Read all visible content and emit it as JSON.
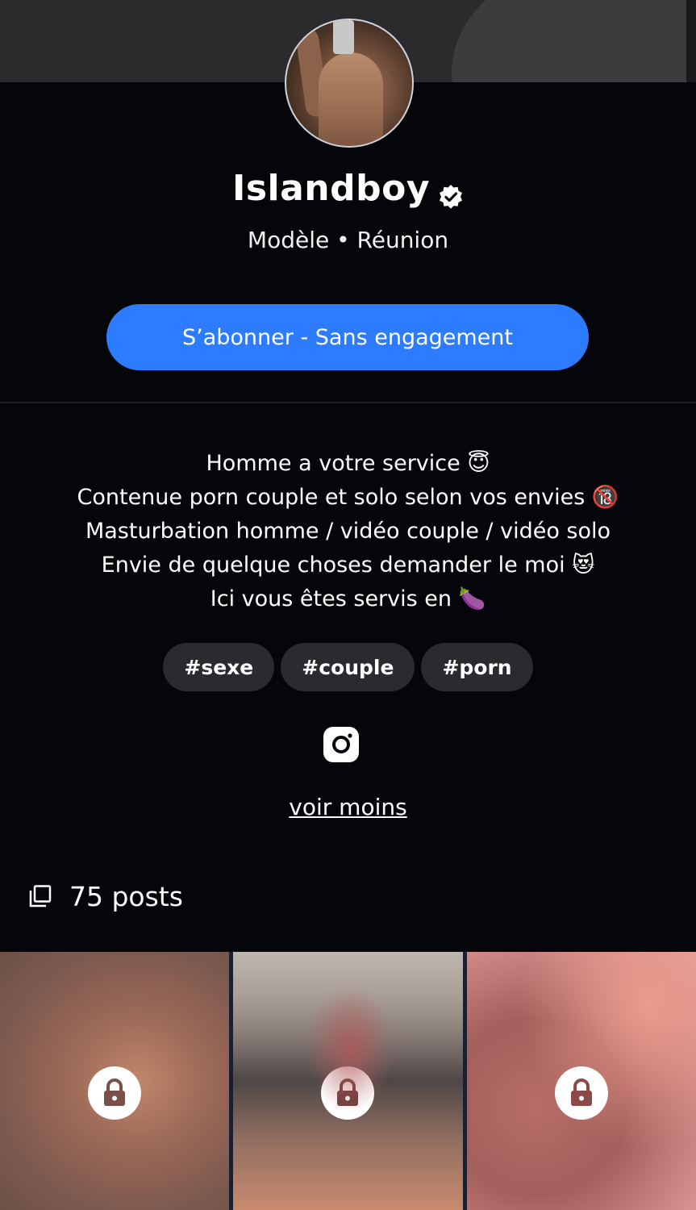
{
  "profile": {
    "name": "Islandboy",
    "subtitle": "Modèle • Réunion",
    "avatar_icon": "profile-photo",
    "verified_icon": "verified-badge-icon"
  },
  "actions": {
    "subscribe_label": "S’abonner - Sans engagement"
  },
  "bio": {
    "lines": [
      "Homme a votre service 😇",
      "Contenue porn couple et solo selon vos envies 🔞",
      "Masturbation homme / vidéo couple / vidéo solo",
      "Envie de quelque choses demander le moi 😻",
      "Ici vous êtes servis en 🍆"
    ]
  },
  "tags": [
    "#sexe",
    "#couple",
    "#porn"
  ],
  "social": {
    "icon": "instagram-icon"
  },
  "toggle": {
    "see_less_label": "voir moins"
  },
  "posts": {
    "count_label": "75 posts",
    "icon": "posts-stack-icon",
    "tiles": [
      {
        "locked": true,
        "icon": "lock-icon"
      },
      {
        "locked": true,
        "icon": "lock-icon"
      },
      {
        "locked": true,
        "icon": "lock-icon"
      }
    ]
  },
  "colors": {
    "background": "#05060a",
    "accent": "#2d7bff",
    "tag_bg": "#2a2b2f",
    "banner": "#2b2b2e"
  }
}
